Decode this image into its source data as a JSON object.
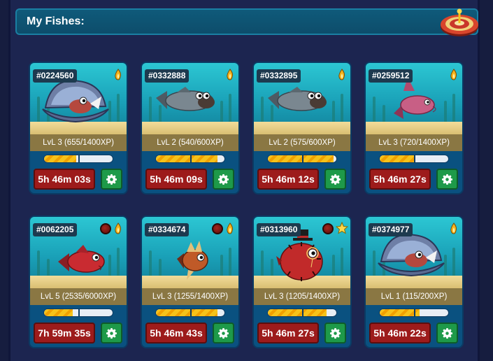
{
  "header": {
    "title": "My Fishes:"
  },
  "colors": {
    "timer": "#9d1b1b",
    "settings": "#1e9a49",
    "xp": "#f5c21a",
    "header": "#0f5a7a"
  },
  "fishes": [
    {
      "id": "#0224560",
      "level": "LvL 3 (655/1400XP)",
      "xp_fraction": 0.47,
      "timer": "5h 46m 03s",
      "species": "clam-fish",
      "badges": [
        "fire"
      ]
    },
    {
      "id": "#0332888",
      "level": "LvL 2 (540/600XP)",
      "xp_fraction": 0.9,
      "timer": "5h 46m 09s",
      "species": "grey-fish",
      "badges": [
        "fire"
      ]
    },
    {
      "id": "#0332895",
      "level": "LvL 2 (575/600XP)",
      "xp_fraction": 0.96,
      "timer": "5h 46m 12s",
      "species": "grey-fish",
      "badges": [
        "fire"
      ]
    },
    {
      "id": "#0259512",
      "level": "LvL 3 (720/1400XP)",
      "xp_fraction": 0.51,
      "timer": "5h 46m 27s",
      "species": "pink-shark",
      "badges": [
        "fire"
      ]
    },
    {
      "id": "#0062205",
      "level": "LvL 5 (2535/6000XP)",
      "xp_fraction": 0.42,
      "timer": "7h 59m 35s",
      "species": "red-fish",
      "badges": [
        "orb",
        "fire"
      ]
    },
    {
      "id": "#0334674",
      "level": "LvL 3 (1255/1400XP)",
      "xp_fraction": 0.9,
      "timer": "5h 46m 43s",
      "species": "lion-fish",
      "badges": [
        "orb",
        "fire"
      ]
    },
    {
      "id": "#0313960",
      "level": "LvL 3 (1205/1400XP)",
      "xp_fraction": 0.86,
      "timer": "5h 46m 27s",
      "species": "puffer-fish",
      "badges": [
        "orb",
        "star"
      ]
    },
    {
      "id": "#0374977",
      "level": "LvL 1 (115/200XP)",
      "xp_fraction": 0.58,
      "timer": "5h 46m 22s",
      "species": "clam-fish",
      "badges": [
        "fire"
      ]
    }
  ],
  "icons": {
    "settings": "gear-icon",
    "fire": "fire-icon",
    "star": "star-icon",
    "orb": "orb-icon",
    "roulette": "roulette-icon"
  }
}
